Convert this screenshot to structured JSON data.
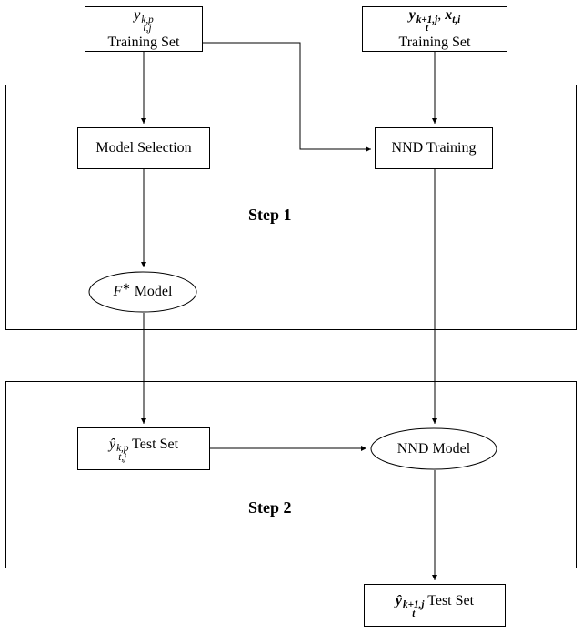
{
  "nodes": {
    "topLeft": {
      "math_html": "<span class='mi'>y</span><span class='supsub'><span class='top mi'>k,p</span><span class='bot mi'>t,j</span></span>",
      "subtitle": "Training Set"
    },
    "topRight": {
      "math_html": "<span class='bm'>y</span><span class='supsub'><span class='top bm'>k+1,j</span><span class='bot bm'>t</span></span><span>, </span><span class='bm'>x</span><span class='sub bm'>t,i</span>",
      "subtitle": "Training Set"
    },
    "modelSelection": {
      "label": "Model Selection"
    },
    "nndTraining": {
      "label": "NND Training"
    },
    "fstar": {
      "math_html": "<span class='mi'>F</span><span class='sup'>∗</span><span> Model</span>"
    },
    "yhatTest": {
      "math_html": "<span class='mi'>ŷ</span><span class='supsub'><span class='top mi'>k,p</span><span class='bot mi'>t,j</span></span><span> Test Set</span>"
    },
    "nndModel": {
      "label": "NND Model"
    },
    "finalTest": {
      "math_html": "<span class='bm'>ŷ</span><span class='supsub'><span class='top bm'>k+1,j</span><span class='bot bm'>t</span></span><span> Test Set</span>"
    }
  },
  "steps": {
    "step1": "Step 1",
    "step2": "Step 2"
  }
}
